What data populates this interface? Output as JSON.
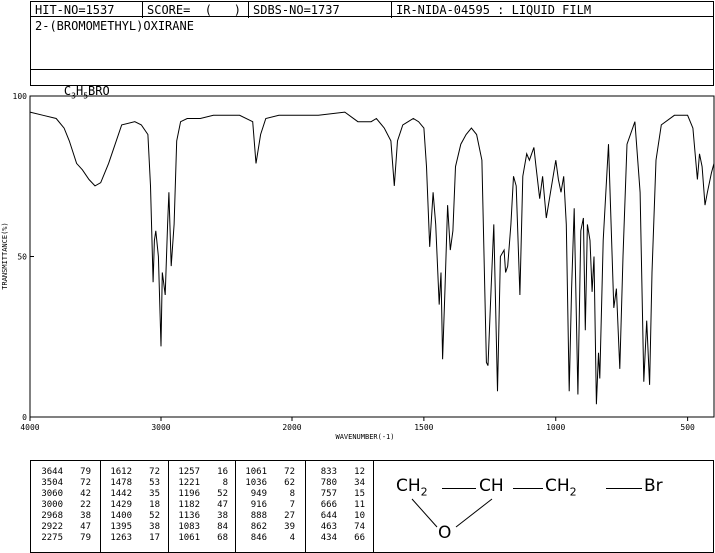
{
  "header": {
    "hit_no": "HIT-NO=1537",
    "score": "SCORE=  (   )",
    "sdbs_no": "SDBS-NO=1737",
    "ir_no": "IR-NIDA-04595 : LIQUID FILM"
  },
  "compound": {
    "name": "2-(BROMOMETHYL)OXIRANE",
    "formula_parts": [
      "C",
      "3",
      "H",
      "5",
      "BRO"
    ]
  },
  "chart_data": {
    "type": "line",
    "xlabel": "WAVENUMBER(-1)",
    "ylabel": "TRANSMITTANCE(%)",
    "xlim": [
      4000,
      400
    ],
    "ylim": [
      0,
      100
    ],
    "x_ticks": [
      4000,
      3000,
      2000,
      1500,
      1000,
      500
    ],
    "y_ticks": [
      0,
      50,
      100
    ],
    "grid": false,
    "series": [
      {
        "color": "#000000",
        "x": [
          4000,
          3900,
          3800,
          3740,
          3700,
          3644,
          3600,
          3550,
          3504,
          3460,
          3400,
          3300,
          3200,
          3150,
          3100,
          3080,
          3060,
          3050,
          3040,
          3020,
          3000,
          2990,
          2980,
          2968,
          2950,
          2940,
          2922,
          2900,
          2880,
          2850,
          2800,
          2700,
          2600,
          2500,
          2400,
          2300,
          2275,
          2240,
          2200,
          2100,
          2000,
          1900,
          1800,
          1750,
          1700,
          1680,
          1650,
          1625,
          1612,
          1600,
          1580,
          1560,
          1540,
          1520,
          1500,
          1490,
          1478,
          1465,
          1455,
          1442,
          1435,
          1429,
          1420,
          1410,
          1400,
          1390,
          1380,
          1360,
          1340,
          1320,
          1300,
          1280,
          1263,
          1257,
          1245,
          1235,
          1221,
          1210,
          1196,
          1190,
          1182,
          1170,
          1160,
          1150,
          1136,
          1125,
          1110,
          1100,
          1083,
          1075,
          1061,
          1050,
          1036,
          1020,
          1000,
          990,
          980,
          970,
          960,
          949,
          940,
          930,
          916,
          905,
          895,
          888,
          880,
          870,
          862,
          855,
          846,
          838,
          833,
          820,
          800,
          790,
          780,
          770,
          757,
          745,
          730,
          700,
          680,
          666,
          655,
          644,
          635,
          620,
          600,
          550,
          500,
          480,
          463,
          455,
          445,
          434,
          425,
          410,
          400
        ],
        "y": [
          95,
          94,
          93,
          90,
          86,
          79,
          77,
          74,
          72,
          73,
          79,
          91,
          92,
          91,
          88,
          72,
          42,
          55,
          58,
          50,
          22,
          45,
          42,
          38,
          60,
          70,
          47,
          60,
          86,
          92,
          93,
          93,
          94,
          94,
          94,
          92,
          79,
          88,
          93,
          94,
          94,
          94,
          95,
          92,
          92,
          93,
          90,
          86,
          72,
          86,
          91,
          92,
          93,
          92,
          90,
          78,
          53,
          70,
          60,
          35,
          45,
          18,
          40,
          66,
          52,
          58,
          78,
          85,
          88,
          90,
          88,
          80,
          17,
          16,
          40,
          60,
          8,
          50,
          52,
          45,
          47,
          60,
          75,
          72,
          38,
          75,
          82,
          80,
          84,
          78,
          68,
          75,
          62,
          70,
          80,
          74,
          70,
          75,
          60,
          8,
          40,
          65,
          7,
          58,
          62,
          27,
          60,
          55,
          39,
          50,
          4,
          20,
          12,
          55,
          85,
          60,
          34,
          40,
          15,
          50,
          85,
          92,
          70,
          11,
          30,
          10,
          45,
          80,
          91,
          94,
          94,
          90,
          74,
          82,
          78,
          66,
          70,
          76,
          79
        ]
      }
    ]
  },
  "peak_table": [
    [
      [
        "3644",
        "79"
      ],
      [
        "3504",
        "72"
      ],
      [
        "3060",
        "42"
      ],
      [
        "3000",
        "22"
      ],
      [
        "2968",
        "38"
      ],
      [
        "2922",
        "47"
      ],
      [
        "2275",
        "79"
      ]
    ],
    [
      [
        "1612",
        "72"
      ],
      [
        "1478",
        "53"
      ],
      [
        "1442",
        "35"
      ],
      [
        "1429",
        "18"
      ],
      [
        "1400",
        "52"
      ],
      [
        "1395",
        "38"
      ],
      [
        "1263",
        "17"
      ]
    ],
    [
      [
        "1257",
        "16"
      ],
      [
        "1221",
        "8"
      ],
      [
        "1196",
        "52"
      ],
      [
        "1182",
        "47"
      ],
      [
        "1136",
        "38"
      ],
      [
        "1083",
        "84"
      ],
      [
        "1061",
        "68"
      ]
    ],
    [
      [
        "1061",
        "72"
      ],
      [
        "1036",
        "62"
      ],
      [
        "949",
        "8"
      ],
      [
        "916",
        "7"
      ],
      [
        "888",
        "27"
      ],
      [
        "862",
        "39"
      ],
      [
        "846",
        "4"
      ]
    ],
    [
      [
        "833",
        "12"
      ],
      [
        "780",
        "34"
      ],
      [
        "757",
        "15"
      ],
      [
        "666",
        "11"
      ],
      [
        "644",
        "10"
      ],
      [
        "463",
        "74"
      ],
      [
        "434",
        "66"
      ]
    ]
  ],
  "structure": {
    "ch2_left": "CH",
    "sub_2_left": "2",
    "ch_mid": "CH",
    "ch2_right": "CH",
    "sub_2_right": "2",
    "br": "Br",
    "o": "O"
  }
}
